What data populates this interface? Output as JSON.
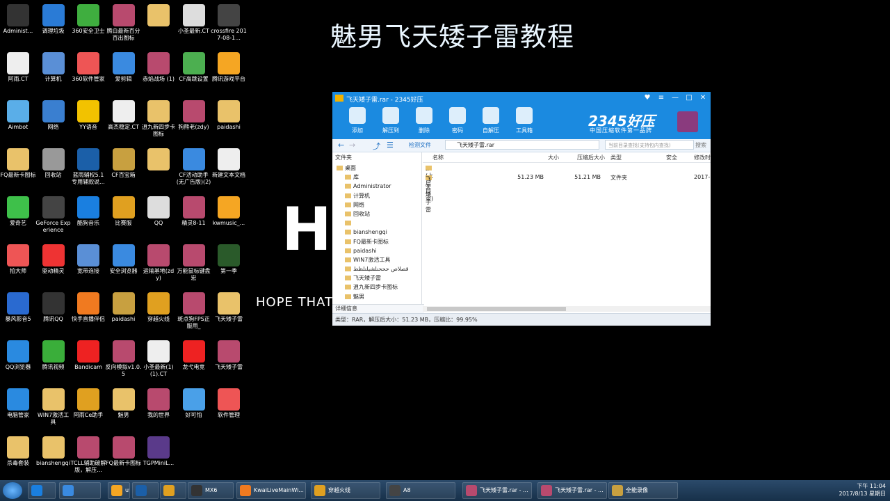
{
  "video_title": "魅男飞天矮子雷教程",
  "video_overlay": {
    "big_letter": "H",
    "caption": "HOPE THAT"
  },
  "desktop_icons": [
    {
      "label": "Administ...",
      "color": "#333"
    },
    {
      "label": "调理垃圾",
      "color": "#2a7bd6"
    },
    {
      "label": "360安全卫士",
      "color": "#3fae3f"
    },
    {
      "label": "腾白最新百分百出图标",
      "color": "#b84a6e"
    },
    {
      "label": "",
      "color": "#e9c26a"
    },
    {
      "label": "小圣最新.CT",
      "color": "#ddd"
    },
    {
      "label": "crossfire 2017-08-1...",
      "color": "#444"
    },
    {
      "label": "阿雨.CT",
      "color": "#eee"
    },
    {
      "label": "计算机",
      "color": "#5a8fd6"
    },
    {
      "label": "360软件管家",
      "color": "#e55"
    },
    {
      "label": "爱剪辑",
      "color": "#3a8ae0"
    },
    {
      "label": "赤焰战场 (1)",
      "color": "#b84a6e"
    },
    {
      "label": "CF高跳设置",
      "color": "#4caf50"
    },
    {
      "label": "腾讯游戏平台",
      "color": "#f5a623"
    },
    {
      "label": "Aimbot",
      "color": "#5aaee8"
    },
    {
      "label": "网络",
      "color": "#3a7fd0"
    },
    {
      "label": "YY语音",
      "color": "#f2c200"
    },
    {
      "label": "高杰稳定.CT",
      "color": "#eee"
    },
    {
      "label": "逍九新四步卡图标",
      "color": "#e9c26a"
    },
    {
      "label": "狗熊老(zdy)",
      "color": "#b84a6e"
    },
    {
      "label": "paidashi",
      "color": "#e9c26a"
    },
    {
      "label": "FQ最新卡图标",
      "color": "#e9c26a"
    },
    {
      "label": "回收站",
      "color": "#999"
    },
    {
      "label": "蓝雨辅权5.1专用辅款说...",
      "color": "#1b5fa8"
    },
    {
      "label": "CF百宝箱",
      "color": "#c8a040"
    },
    {
      "label": "",
      "color": "#e9c26a"
    },
    {
      "label": "CF活动助手(无广告版)(2)",
      "color": "#3a8ae0"
    },
    {
      "label": "新建文本文档",
      "color": "#eee"
    },
    {
      "label": "爱奇艺",
      "color": "#3ec04a"
    },
    {
      "label": "GeForce Experience",
      "color": "#444"
    },
    {
      "label": "酷狗音乐",
      "color": "#1a7fe0"
    },
    {
      "label": "比赛服",
      "color": "#e0a020"
    },
    {
      "label": "QQ",
      "color": "#ddd"
    },
    {
      "label": "精灵8-11",
      "color": "#b84a6e"
    },
    {
      "label": "kwmusic_...",
      "color": "#f5a623"
    },
    {
      "label": "拍大师",
      "color": "#e55"
    },
    {
      "label": "驱动精灵",
      "color": "#e33"
    },
    {
      "label": "宽带连接",
      "color": "#5a8fd6"
    },
    {
      "label": "安全浏览器",
      "color": "#3a8ae0"
    },
    {
      "label": "运输基地(zdy)",
      "color": "#b84a6e"
    },
    {
      "label": "万能鼠标键盘宏",
      "color": "#b84a6e"
    },
    {
      "label": "第一季",
      "color": "#2a5a2a"
    },
    {
      "label": "暴风影音5",
      "color": "#2a6ad0"
    },
    {
      "label": "腾讯QQ",
      "color": "#333"
    },
    {
      "label": "快手直播伴侣",
      "color": "#f07a20"
    },
    {
      "label": "paidashi",
      "color": "#c8a040"
    },
    {
      "label": "穿越火线",
      "color": "#e0a020"
    },
    {
      "label": "斑点狗FPS正服用_",
      "color": "#b84a6e"
    },
    {
      "label": "飞天矮子雷",
      "color": "#e9c26a"
    },
    {
      "label": "QQ浏览器",
      "color": "#2a8ae0"
    },
    {
      "label": "腾讯视频",
      "color": "#3aae3a"
    },
    {
      "label": "Bandicam",
      "color": "#e22"
    },
    {
      "label": "反向模拟v1.0.5",
      "color": "#b84a6e"
    },
    {
      "label": "小圣最新(1)(1).CT",
      "color": "#eee"
    },
    {
      "label": "龙弋电竞",
      "color": "#e22"
    },
    {
      "label": "飞天矮子雷",
      "color": "#b84a6e"
    },
    {
      "label": "电脑管家",
      "color": "#2a8ae0"
    },
    {
      "label": "WIN7激活工具",
      "color": "#e9c26a"
    },
    {
      "label": "阿雨Ce助手",
      "color": "#e0a020"
    },
    {
      "label": "魅男",
      "color": "#e9c26a"
    },
    {
      "label": "我的世界",
      "color": "#b84a6e"
    },
    {
      "label": "好可怕",
      "color": "#4aa0e8"
    },
    {
      "label": "软件管理",
      "color": "#e55"
    },
    {
      "label": "杀毒套装",
      "color": "#e9c26a"
    },
    {
      "label": "bianshengqi",
      "color": "#e9c26a"
    },
    {
      "label": "TCLL辅助破解版，解压...",
      "color": "#b84a6e"
    },
    {
      "label": "FQ最新卡图标",
      "color": "#b84a6e"
    },
    {
      "label": "TGPMiniL...",
      "color": "#5a3a8a"
    }
  ],
  "window": {
    "title": "飞天矮子雷.rar - 2345好压",
    "brand": "2345好压",
    "brand_sub": "中国压缩软件第一品牌",
    "toolbar": [
      {
        "label": "添加",
        "color": "#ffffff"
      },
      {
        "label": "解压到",
        "color": "#ffffff"
      },
      {
        "label": "删除",
        "color": "#ffffff"
      },
      {
        "label": "密码",
        "color": "#ffffff"
      },
      {
        "label": "自解压",
        "color": "#ffffff"
      },
      {
        "label": "工具箱",
        "color": "#ffffff"
      }
    ],
    "detect_label": "检测文件",
    "path": "飞天矮子雷.rar",
    "search_placeholder": "当前目录查找(支持包内查找)",
    "search_button": "搜索",
    "tree_header": "文件夹",
    "tree": [
      {
        "label": "桌面",
        "indent": 0
      },
      {
        "label": "库",
        "indent": 1
      },
      {
        "label": "Administrator",
        "indent": 1
      },
      {
        "label": "计算机",
        "indent": 1
      },
      {
        "label": "网络",
        "indent": 1
      },
      {
        "label": "回收站",
        "indent": 1
      },
      {
        "label": "",
        "indent": 1
      },
      {
        "label": "bianshengqi",
        "indent": 1
      },
      {
        "label": "FQ最新卡图标",
        "indent": 1
      },
      {
        "label": "paidashi",
        "indent": 1
      },
      {
        "label": "WIN7激活工具",
        "indent": 1
      },
      {
        "label": "قصلاص حححنلشيلنلظط",
        "indent": 1
      },
      {
        "label": "飞天矮子雷",
        "indent": 1
      },
      {
        "label": "逍九新四步卡图标",
        "indent": 1
      },
      {
        "label": "魅男",
        "indent": 1
      }
    ],
    "details_header": "详细信息",
    "columns": {
      "name": "名称",
      "size": "大小",
      "packed": "压缩后大小",
      "type": "类型",
      "security": "安全",
      "modified": "修改时"
    },
    "rows": [
      {
        "name": "..(上层目录)",
        "size": "",
        "packed": "",
        "type": "",
        "modified": ""
      },
      {
        "name": "飞天矮子雷",
        "size": "51.23 MB",
        "packed": "51.21 MB",
        "type": "文件夹",
        "modified": "2017-"
      }
    ],
    "status": "类型：RAR，解压后大小：51.23 MB，压缩比：99.95%"
  },
  "taskbar": {
    "tasks": [
      {
        "label": "",
        "left": 0
      },
      {
        "label": "",
        "left": 0
      },
      {
        "label": "uvuon - 酷狗音乐",
        "left": 0
      },
      {
        "label": "",
        "left": 0
      },
      {
        "label": "",
        "left": 0
      },
      {
        "label": "MX6",
        "left": 0
      },
      {
        "label": "KwaiLiveMainWi...",
        "left": 0
      },
      {
        "label": "穿越火线",
        "left": 0
      },
      {
        "label": "A8",
        "left": 0
      },
      {
        "label": "飞天矮子雷.rar - ...",
        "left": 0
      },
      {
        "label": "飞天矮子雷.rar - ...",
        "left": 0
      },
      {
        "label": "全能录像",
        "left": 0
      }
    ],
    "time": "下午 11:04",
    "date": "2017/8/13 星期日"
  }
}
